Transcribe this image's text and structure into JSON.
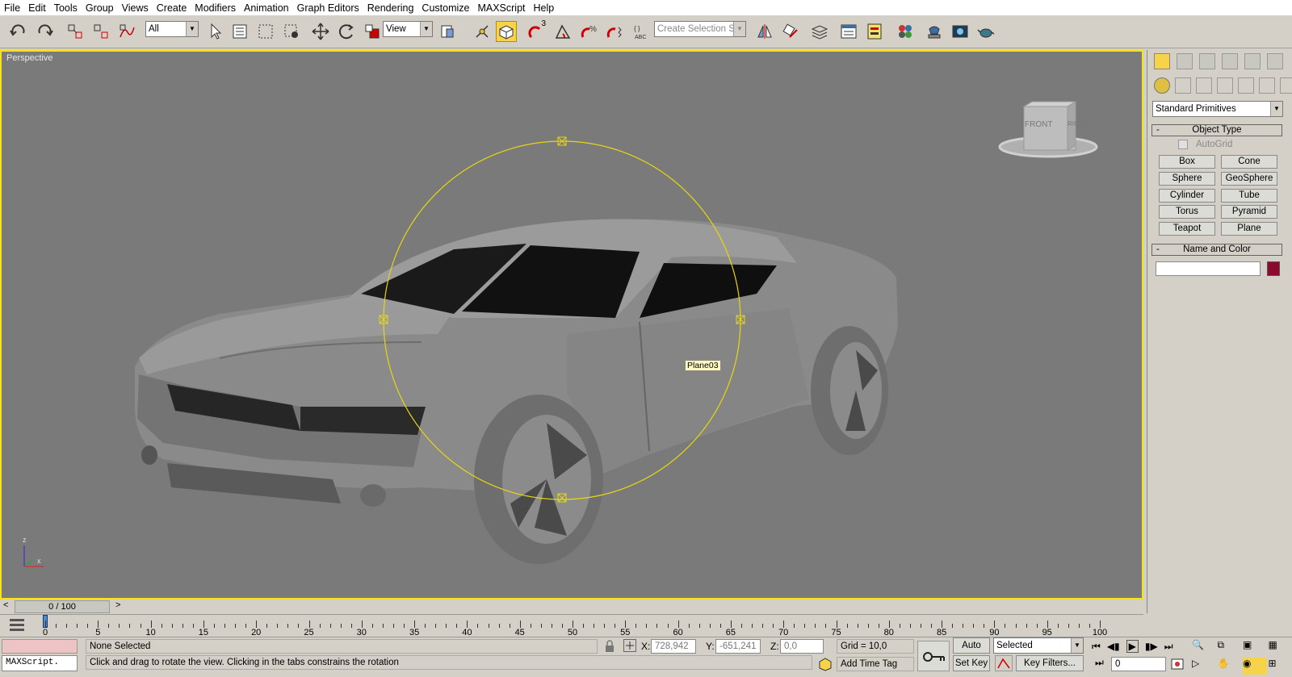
{
  "menu": [
    "File",
    "Edit",
    "Tools",
    "Group",
    "Views",
    "Create",
    "Modifiers",
    "Animation",
    "Graph Editors",
    "Rendering",
    "Customize",
    "MAXScript",
    "Help"
  ],
  "toolbar": {
    "filter_value": "All",
    "refcoord_value": "View",
    "selection_set_placeholder": "Create Selection Set",
    "snap_label": "3"
  },
  "viewport": {
    "label": "Perspective",
    "object_tooltip": "Plane03",
    "viewcube_front": "FRONT",
    "viewcube_right": "RIGHT",
    "axis_z": "z",
    "axis_x": "x"
  },
  "command_panel": {
    "category": "Standard Primitives",
    "object_type_title": "Object Type",
    "autogrid_label": "AutoGrid",
    "primitives": [
      "Box",
      "Cone",
      "Sphere",
      "GeoSphere",
      "Cylinder",
      "Tube",
      "Torus",
      "Pyramid",
      "Teapot",
      "Plane"
    ],
    "name_color_title": "Name and Color",
    "color_swatch": "#8b0a2e",
    "rollout_toggle": "-"
  },
  "timeline": {
    "frame_display": "0 / 100",
    "left_arrow": "<",
    "right_arrow": ">",
    "ticks": [
      "0",
      "5",
      "10",
      "15",
      "20",
      "25",
      "30",
      "35",
      "40",
      "45",
      "50",
      "55",
      "60",
      "65",
      "70",
      "75",
      "80",
      "85",
      "90",
      "95",
      "100"
    ]
  },
  "status": {
    "maxscript_label": "MAXScript.",
    "selection": "None Selected",
    "prompt": "Click and drag to rotate the view.  Clicking in the tabs constrains the rotation",
    "x_label": "X:",
    "x_value": "728,942",
    "y_label": "Y:",
    "y_value": "-651,241",
    "z_label": "Z:",
    "z_value": "0,0",
    "grid": "Grid = 10,0",
    "add_time_tag": "Add Time Tag",
    "auto_key": "Auto Key",
    "set_key": "Set Key",
    "key_mode": "Selected",
    "key_filters": "Key Filters...",
    "frame_value": "0"
  }
}
